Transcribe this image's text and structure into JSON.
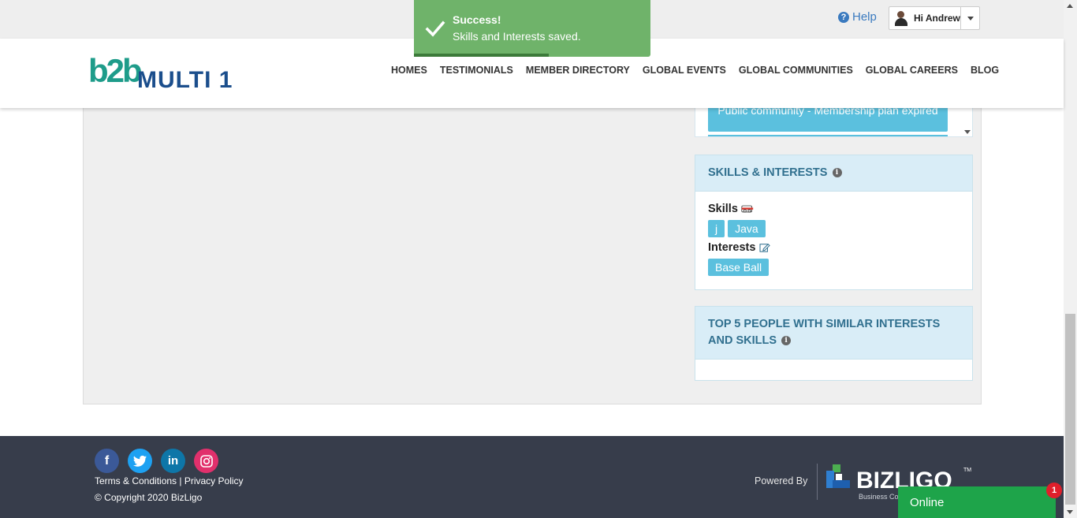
{
  "topbar": {
    "help_label": "Help",
    "user_greeting": "Hi Andrew"
  },
  "header": {
    "logo_b2b": "b2b",
    "logo_name": "MULTI 1",
    "nav": [
      "HOMES",
      "TESTIMONIALS",
      "MEMBER DIRECTORY",
      "GLOBAL EVENTS",
      "GLOBAL COMMUNITIES",
      "GLOBAL CAREERS",
      "BLOG"
    ]
  },
  "community": {
    "button_label": "Public community - Membership plan expired"
  },
  "skills_widget": {
    "title": "SKILLS & INTERESTS",
    "skills_label": "Skills",
    "skills": [
      "j",
      "Java"
    ],
    "interests_label": "Interests",
    "interests": [
      "Base Ball"
    ]
  },
  "similar_widget": {
    "title": "TOP 5 PEOPLE WITH SIMILAR INTERESTS AND SKILLS"
  },
  "footer": {
    "social": [
      {
        "name": "facebook-icon",
        "glyph": "f"
      },
      {
        "name": "twitter-icon",
        "glyph": "t"
      },
      {
        "name": "linkedin-icon",
        "glyph": "in"
      },
      {
        "name": "instagram-icon",
        "glyph": "◎"
      }
    ],
    "terms": "Terms & Conditions",
    "separator": " | ",
    "privacy": "Privacy Policy",
    "copyright": "© Copyright 2020 BizLigo",
    "powered_by": "Powered By",
    "brand": "BIZLIGO",
    "brand_tm": "TM",
    "brand_sub": "Business Co"
  },
  "chat": {
    "label": "Online",
    "badge": "1"
  },
  "toast": {
    "title": "Success!",
    "message": "Skills and Interests saved.",
    "progress": 0.57
  },
  "colors": {
    "accent_blue": "#5bc0de",
    "panel_head": "#d9edf7",
    "panel_title": "#31708f",
    "footer_bg": "#373d4b",
    "toast_green": "#6fb36a",
    "chat_green": "#1ea44a"
  }
}
